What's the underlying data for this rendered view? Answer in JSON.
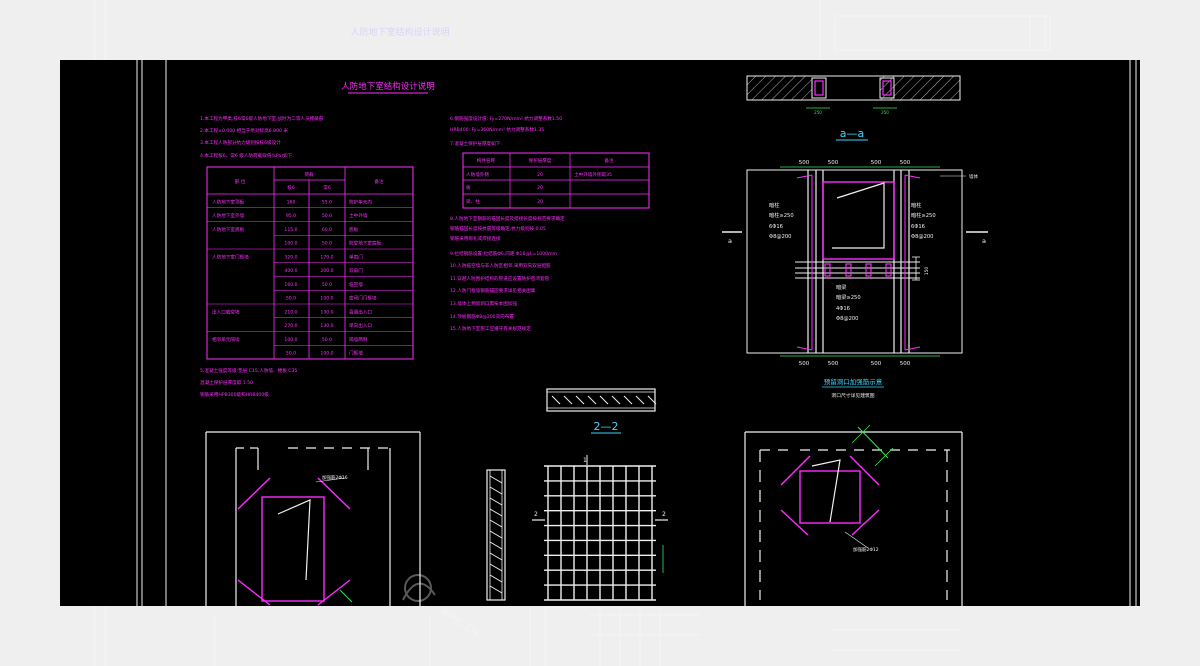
{
  "drawing": {
    "title": "人防地下室结构设计说明",
    "notes_left": [
      "1.本工程为甲类,核6常6级人防地下室,战时为二等人员掩蔽部",
      "2.本工程±0.000 相当于绝对标高6.800 米",
      "3.本工程人防部分抗力级别按核6级设计",
      "4.本工程核6、常6 级人防荷载取值(kPa)如下:"
    ],
    "load_table": {
      "header": [
        "部 位",
        "荷载",
        "备注"
      ],
      "subheader": [
        "核6",
        "常6"
      ],
      "rows": [
        [
          "人防地下室顶板",
          "160",
          "55.0",
          "防护单元内"
        ],
        [
          "人防地下室外墙",
          "95.0",
          "50.0",
          "土中外墙"
        ],
        [
          "人防地下室底板",
          "115.0",
          "60.0",
          "底板"
        ],
        [
          "",
          "100.0",
          "50.0",
          "防空地下室底板"
        ],
        [
          "人防地下室门框墙",
          "320.0",
          "170.0",
          "单扇门"
        ],
        [
          "",
          "400.0",
          "200.0",
          "双扇门"
        ],
        [
          "",
          "160.0",
          "50.0",
          "临空墙"
        ],
        [
          "",
          "50.0",
          "100.0",
          "密闭门门框墙"
        ],
        [
          "出入口临空墙",
          "210.0",
          "130.0",
          "直通出入口"
        ],
        [
          "",
          "270.0",
          "130.0",
          "单向出入口"
        ],
        [
          "相邻单元隔墙",
          "100.0",
          "50.0",
          "隔墙两侧"
        ],
        [
          "",
          "50.0",
          "100.0",
          "门框墙"
        ]
      ]
    },
    "notes_left_bottom": [
      "5.混凝土强度等级:垫层 C15,人防墙、楼板 C35",
      "  混凝土保护层厚度取 1.50",
      "  钢筋采用HPB300级和HRB400级"
    ],
    "notes_right_top": [
      "6.钢筋强度设计值: Fy=270N/mm² 抗力调整系数1.50",
      "  HRB400: Fy=360N/mm² 抗力调整系数1.35",
      "7.混凝土保护层厚度如下:"
    ],
    "cover_table": {
      "header": [
        "构件名称",
        "保护层厚度",
        "备注"
      ],
      "rows": [
        [
          "人防墙外侧",
          "20",
          "土中外墙外侧取35"
        ],
        [
          "板",
          "20",
          ""
        ],
        [
          "梁、柱",
          "20",
          ""
        ]
      ]
    },
    "notes_right": [
      "8.人防地下室钢筋的锚固长度及搭接长度按规范要求确定",
      "  钢筋锚固长度按抗震等级确定,抗力级别按 0.05",
      "  钢筋采用绑扎或焊接连接",
      "9.拉结钢筋设置:拉结筋Φ6,间距 Φ16@L=1000mm",
      "10.人防临空墙与非人防区相邻,采用双向双层配筋",
      "11.穿越人防围护结构的管道应设置防护密闭套管",
      "12.人防门框墙钢筋锚固要求详见相关图集",
      "13.墙体上预留洞口需按本图加强",
      "14.顶板钢筋Φ8@200双向布置",
      "15.人防地下室施工应遵守有关规范规定"
    ],
    "section_a_label": "a—a",
    "section_2_label": "2—2",
    "section_marker_2": "2",
    "section_marker_1": "1",
    "axis_a": "a",
    "dims": [
      "500",
      "500",
      "500",
      "500"
    ],
    "dim_150": "150",
    "dim_250": "250",
    "wall_label": "墙体",
    "left_rebar": [
      "暗柱",
      "暗柱≥250",
      "6Φ16",
      "Φ8@200"
    ],
    "right_rebar": [
      "暗柱",
      "暗柱≥250",
      "6Φ16",
      "Φ8@200"
    ],
    "mid_rebar": [
      "暗梁",
      "暗梁≥250",
      "4Φ16",
      "Φ8@200"
    ],
    "opening_caption": "预留洞口加强筋示意",
    "opening_subcaption": "洞口尺寸详见建筑图",
    "rebar_left_label": "加强筋2Φ16",
    "rebar_right_label": "加强筋2Φ12",
    "watermark": "NIPIC.CN"
  },
  "colors": {
    "canvas": "#000000",
    "frame": "#ffffff",
    "text_magenta": "#ff2cff",
    "text_blue": "#6da4ff",
    "text_red": "#ff5e5e",
    "text_yellow": "#ffff66",
    "line_white": "#f0f0f0",
    "line_cyan": "#3dd5ff",
    "line_green": "#38e35a"
  }
}
